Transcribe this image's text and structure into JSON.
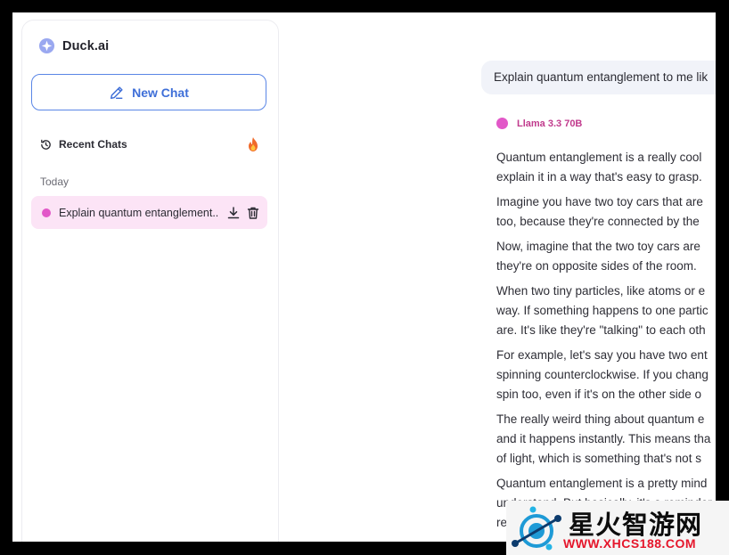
{
  "sidebar": {
    "brand": "Duck.ai",
    "new_chat": "New Chat",
    "recent_title": "Recent Chats",
    "group_label": "Today",
    "chats": [
      {
        "title": "Explain quantum entanglement..."
      }
    ]
  },
  "conversation": {
    "user_message": "Explain quantum entanglement to me lik",
    "model_name": "Llama 3.3 70B",
    "answer_lines": [
      [
        "Quantum entanglement is a really cool",
        "explain it in a way that's easy to grasp."
      ],
      [
        "Imagine you have two toy cars that are",
        "too, because they're connected by the"
      ],
      [
        "Now, imagine that the two toy cars are",
        "they're on opposite sides of the room."
      ],
      [
        "When two tiny particles, like atoms or e",
        "way. If something happens to one partic",
        "are. It's like they're \"talking\" to each oth"
      ],
      [
        "For example, let's say you have two ent",
        "spinning counterclockwise. If you chang",
        "spin too, even if it's on the other side o"
      ],
      [
        "The really weird thing about quantum e",
        "and it happens instantly. This means tha",
        "of light, which is something that's not s"
      ],
      [
        "Quantum entanglement is a pretty mind",
        "understand. But basically, it's a reminder",
        "re..."
      ]
    ]
  },
  "watermark": {
    "brand_cn": "星火智游网",
    "url": "WWW.XHCS188.COM"
  },
  "colors": {
    "accent_blue": "#3f6fd8",
    "model_pink": "#e258c8",
    "selected_chat_bg": "#fce4f6"
  }
}
